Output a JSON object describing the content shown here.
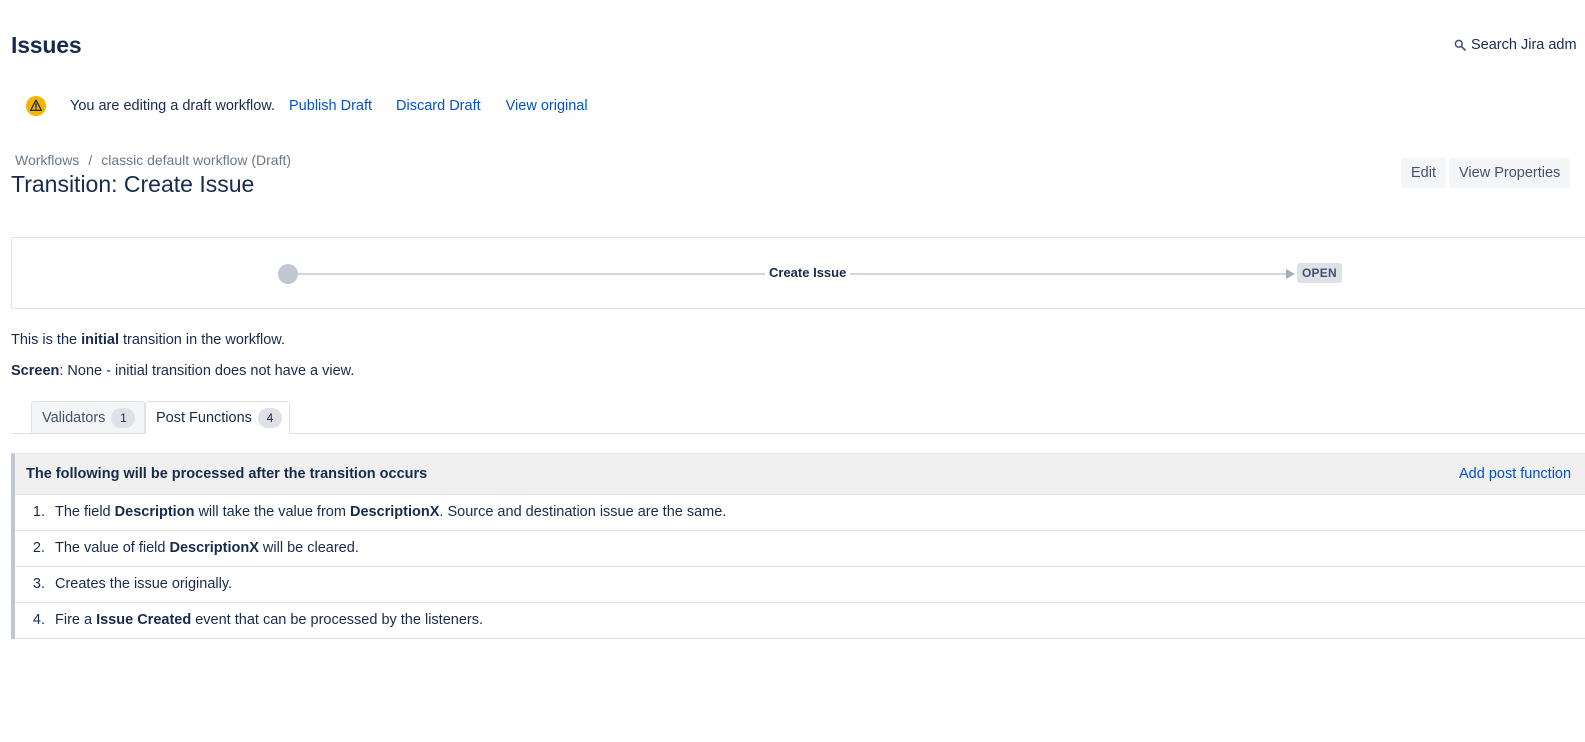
{
  "header": {
    "title": "Issues",
    "admin_search_label": "Search Jira adm"
  },
  "draft_notice": {
    "message": "You are editing a draft workflow.",
    "publish_label": "Publish Draft",
    "discard_label": "Discard Draft",
    "view_original_label": "View original"
  },
  "breadcrumb": {
    "root": "Workflows",
    "separator": "/",
    "current": "classic default workflow (Draft)"
  },
  "page_title": "Transition: Create Issue",
  "actions": {
    "edit_label": "Edit",
    "view_properties_label": "View Properties"
  },
  "diagram": {
    "transition_name": "Create Issue",
    "target_status": "OPEN"
  },
  "info": {
    "line1_prefix": "This is the ",
    "line1_bold": "initial",
    "line1_suffix": " transition in the workflow.",
    "screen_label": "Screen",
    "screen_value": ": None - initial transition does not have a view."
  },
  "tabs": [
    {
      "label": "Validators",
      "count": "1",
      "active": false
    },
    {
      "label": "Post Functions",
      "count": "4",
      "active": true
    }
  ],
  "post_functions": {
    "heading": "The following will be processed after the transition occurs",
    "add_label": "Add post function",
    "items": [
      {
        "number": "1.",
        "parts": [
          {
            "text": "The field ",
            "bold": false
          },
          {
            "text": "Description",
            "bold": true
          },
          {
            "text": " will take the value from ",
            "bold": false
          },
          {
            "text": "DescriptionX",
            "bold": true
          },
          {
            "text": ". Source and destination issue are the same.",
            "bold": false
          }
        ]
      },
      {
        "number": "2.",
        "parts": [
          {
            "text": "The value of field ",
            "bold": false
          },
          {
            "text": "DescriptionX",
            "bold": true
          },
          {
            "text": " will be cleared.",
            "bold": false
          }
        ]
      },
      {
        "number": "3.",
        "parts": [
          {
            "text": "Creates the issue originally.",
            "bold": false
          }
        ]
      },
      {
        "number": "4.",
        "parts": [
          {
            "text": "Fire a ",
            "bold": false
          },
          {
            "text": "Issue Created",
            "bold": true
          },
          {
            "text": " event that can be processed by the listeners.",
            "bold": false
          }
        ]
      }
    ]
  },
  "colors": {
    "link": "#0052cc",
    "text": "#172b4d",
    "warning": "#f5b400",
    "panel_header_bg": "#f0f0f0"
  }
}
